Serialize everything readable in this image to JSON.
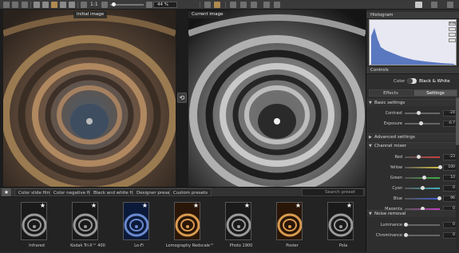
{
  "toolbar": {
    "zoom_ratio": "1:1",
    "zoom_percent": "44 %"
  },
  "viewer": {
    "initial_label": "Initial image",
    "current_label": "Current image",
    "compare_icon": "⟲"
  },
  "preset_tabs": {
    "star": "★",
    "tabs": [
      "Color slide film",
      "Color negative film",
      "Black and white film",
      "Designer presets",
      "Custom presets"
    ],
    "search_placeholder": "Search preset"
  },
  "presets": [
    {
      "name": "Infrared",
      "tone": "bw"
    },
    {
      "name": "Kodak Tri-X™ 400",
      "tone": "bw"
    },
    {
      "name": "Lo-Fi",
      "tone": "blue"
    },
    {
      "name": "Lomography Redscale™",
      "tone": "warm"
    },
    {
      "name": "Photo 1900",
      "tone": "bw"
    },
    {
      "name": "Poster",
      "tone": "warm"
    },
    {
      "name": "Pola",
      "tone": "bw"
    }
  ],
  "panel": {
    "histogram_title": "Histogram",
    "histo_btn_a": "RGB",
    "controls_title": "Controls",
    "toggle_left": "Color",
    "toggle_right": "Black & White",
    "tab_effects": "Effects",
    "tab_settings": "Settings",
    "basic_settings": "Basic settings",
    "advanced_settings": "Advanced settings",
    "channel_mixer": "Channel mixer",
    "noise_removal": "Noise removal"
  },
  "basic": [
    {
      "label": "Contrast",
      "value": "-24",
      "pos": 0.38
    },
    {
      "label": "Exposure",
      "value": "-0.7",
      "pos": 0.46
    }
  ],
  "channels": [
    {
      "label": "Red",
      "value": "-23",
      "pos": 0.38,
      "color": "#d04040"
    },
    {
      "label": "Yellow",
      "value": "100",
      "pos": 1.0,
      "color": "#d0c040"
    },
    {
      "label": "Green",
      "value": "10",
      "pos": 0.55,
      "color": "#40b040"
    },
    {
      "label": "Cyan",
      "value": "0",
      "pos": 0.5,
      "color": "#40b0c0"
    },
    {
      "label": "Blue",
      "value": "96",
      "pos": 0.98,
      "color": "#4060d0"
    },
    {
      "label": "Magenta",
      "value": "0",
      "pos": 0.5,
      "color": "#c040c0"
    }
  ],
  "noise": [
    {
      "label": "Luminance",
      "value": "0",
      "pos": 0.02
    },
    {
      "label": "Chrominance",
      "value": "0",
      "pos": 0.02
    }
  ]
}
